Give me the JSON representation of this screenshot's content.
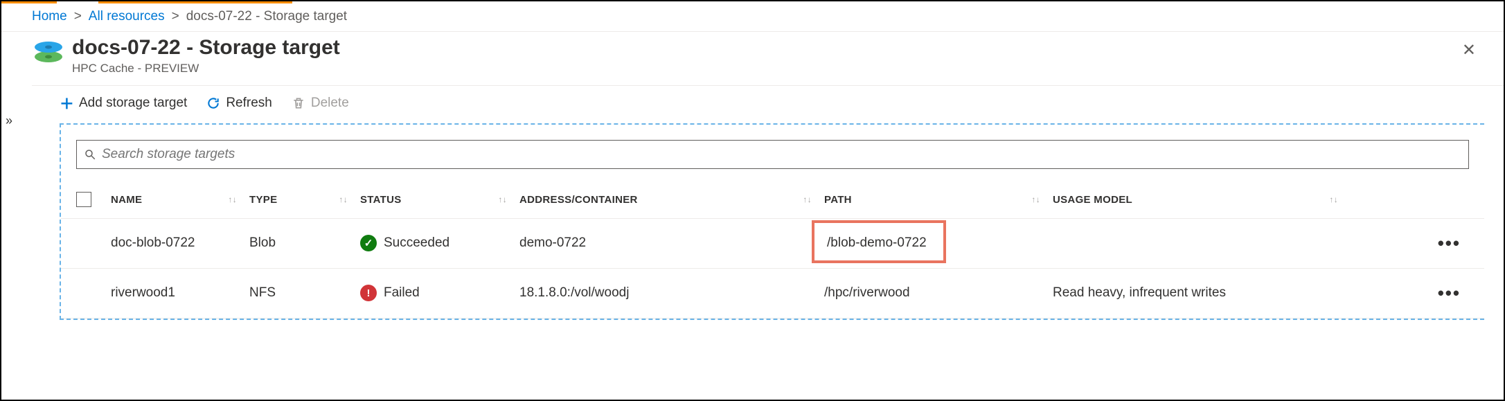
{
  "breadcrumb": {
    "home": "Home",
    "all_resources": "All resources",
    "current": "docs-07-22 - Storage target"
  },
  "header": {
    "title": "docs-07-22 - Storage target",
    "subtitle": "HPC Cache - PREVIEW"
  },
  "toolbar": {
    "add": "Add storage target",
    "refresh": "Refresh",
    "delete": "Delete"
  },
  "search": {
    "placeholder": "Search storage targets"
  },
  "columns": {
    "name": "NAME",
    "type": "TYPE",
    "status": "STATUS",
    "address": "ADDRESS/CONTAINER",
    "path": "PATH",
    "usage": "USAGE MODEL"
  },
  "rows": [
    {
      "name": "doc-blob-0722",
      "type": "Blob",
      "status": "Succeeded",
      "status_kind": "ok",
      "address": "demo-0722",
      "path": "/blob-demo-0722",
      "usage": "",
      "highlight_path": true
    },
    {
      "name": "riverwood1",
      "type": "NFS",
      "status": "Failed",
      "status_kind": "fail",
      "address": "18.1.8.0:/vol/woodj",
      "path": "/hpc/riverwood",
      "usage": "Read heavy, infrequent writes",
      "highlight_path": false
    }
  ],
  "icons": {
    "close": "✕",
    "expand": "»",
    "more": "•••",
    "search": "search-icon",
    "add": "plus-icon",
    "refresh": "refresh-icon",
    "delete": "trash-icon",
    "sort": "↑↓"
  }
}
